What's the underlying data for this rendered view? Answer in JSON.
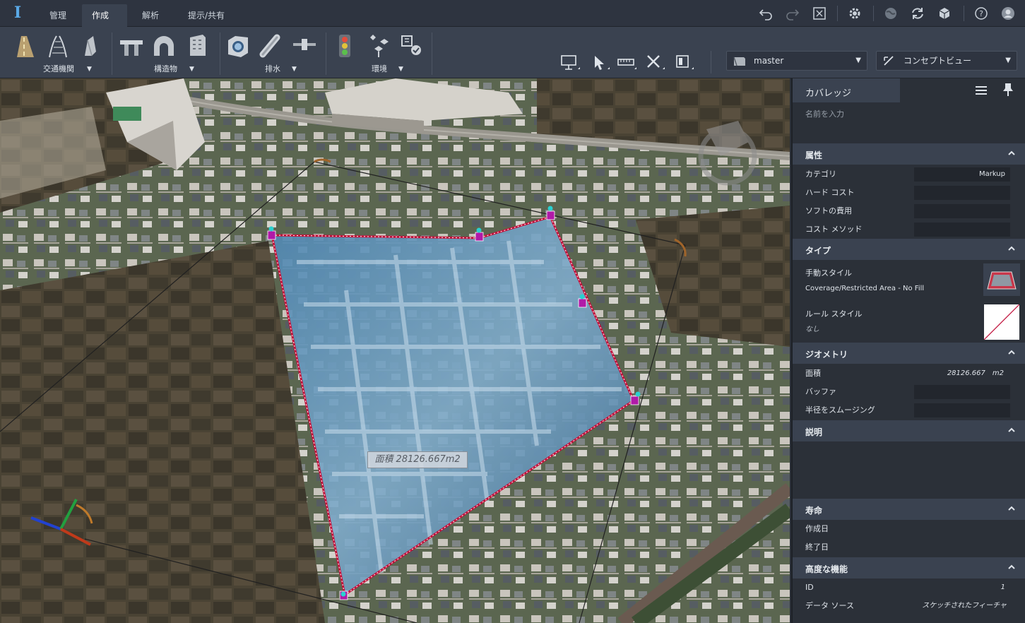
{
  "menubar": {
    "tabs": [
      {
        "label": "管理"
      },
      {
        "label": "作成",
        "active": true
      },
      {
        "label": "解析"
      },
      {
        "label": "提示/共有"
      }
    ],
    "icons": [
      "undo-icon",
      "redo-icon",
      "fit-view-icon",
      "gear-icon",
      "globe-icon",
      "sync-icon",
      "cube-icon",
      "help-icon",
      "user-avatar-icon"
    ]
  },
  "ribbon": {
    "groups": [
      {
        "label": "交通機関"
      },
      {
        "label": "構造物"
      },
      {
        "label": "排水"
      },
      {
        "label": "環境"
      }
    ],
    "dropdowns": {
      "proposal": "master",
      "view": "コンセプトビュー"
    }
  },
  "viewport": {
    "area_label": "面積 28126.667m2"
  },
  "panel": {
    "title": "カバレッジ",
    "name_placeholder": "名前を入力",
    "sections": {
      "attributes": {
        "title": "属性",
        "category_label": "カテゴリ",
        "category_value": "Markup",
        "hard_cost_label": "ハード コスト",
        "soft_cost_label": "ソフトの費用",
        "cost_method_label": "コスト メソッド"
      },
      "type": {
        "title": "タイプ",
        "manual_style_label": "手動スタイル",
        "manual_style_value": "Coverage/Restricted Area - No Fill",
        "rule_style_label": "ルール スタイル",
        "rule_style_value": "なし"
      },
      "geometry": {
        "title": "ジオメトリ",
        "area_label": "面積",
        "area_value": "28126.667　m2",
        "buffer_label": "バッファ",
        "smoothing_label": "半径をスムージング"
      },
      "description": {
        "title": "説明"
      },
      "lifecycle": {
        "title": "寿命",
        "created_label": "作成日",
        "end_label": "終了日"
      },
      "advanced": {
        "title": "高度な機能",
        "id_label": "ID",
        "id_value": "1",
        "source_label": "データ ソース",
        "source_value": "スケッチされたフィーチャ"
      }
    }
  },
  "colors": {
    "accent": "#5aa9e6",
    "boundary": "#c0103a",
    "vertex": "#b01aa8",
    "panel_bg": "#2b3038",
    "section_bg": "#3a4250"
  }
}
